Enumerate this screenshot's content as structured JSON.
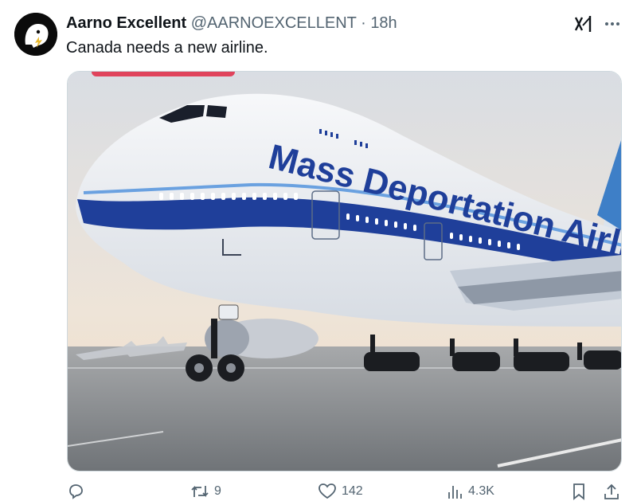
{
  "author": {
    "name": "Aarno Excellent",
    "handle": "@AARNOEXCELLENT",
    "separator": "·",
    "time": "18h",
    "avatar_icon": "ghost-lightning-icon"
  },
  "tweet": {
    "text": "Canada needs a new airline."
  },
  "media": {
    "livery_text": "Mass Deportation Airlines",
    "description_colors": {
      "sky": "#e9e4dc",
      "fuselage": "#eef1f5",
      "stripe": "#1f3f9a",
      "tarmac": "#8b8f94"
    }
  },
  "actions": {
    "reply": {
      "icon": "reply-icon",
      "count": ""
    },
    "retweet": {
      "icon": "retweet-icon",
      "count": "9"
    },
    "like": {
      "icon": "heart-icon",
      "count": "142"
    },
    "views": {
      "icon": "views-icon",
      "count": "4.3K"
    },
    "bookmark": {
      "icon": "bookmark-icon"
    },
    "share": {
      "icon": "share-icon"
    }
  },
  "header_icons": {
    "grok": "xai-grok-icon",
    "more": "more-icon"
  }
}
